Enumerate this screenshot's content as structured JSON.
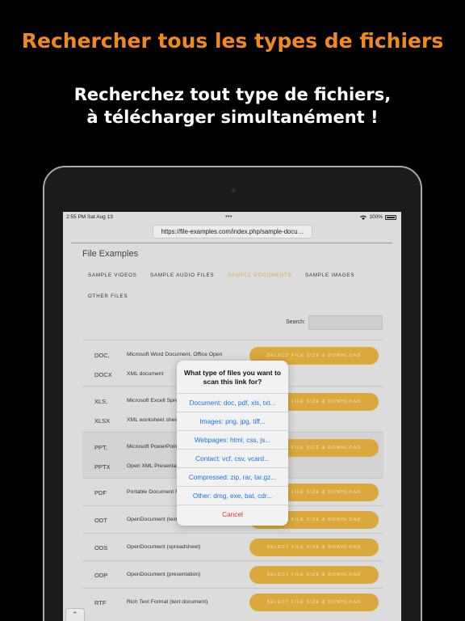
{
  "promo": {
    "title": "Rechercher tous les types de fichiers",
    "subtitle_line1": "Recherchez tout type de fichiers,",
    "subtitle_line2": "à télécharger simultanément !"
  },
  "status_bar": {
    "time": "2:55 PM  Sat Aug 13",
    "more": "•••",
    "battery": "100%"
  },
  "browser": {
    "url": "https://file-examples.com/index.php/sample-docu…"
  },
  "site": {
    "title": "File Examples",
    "nav": [
      "SAMPLE VIDEOS",
      "SAMPLE AUDIO FILES",
      "SAMPLE DOCUMENTS",
      "SAMPLE IMAGES",
      "OTHER FILES"
    ],
    "active_nav": "SAMPLE DOCUMENTS",
    "search_label": "Search:"
  },
  "files": [
    {
      "ext": "DOC,",
      "desc": "Microsoft Word Document, Office Open",
      "button": "SELECT FILE SIZE & DOWNLOAD"
    },
    {
      "ext": "DOCX",
      "desc": "XML document",
      "button": ""
    },
    {
      "ext": "XLS,",
      "desc": "Microsoft Excell Spreadsheet",
      "button": "SELECT FILE SIZE & DOWNLOAD"
    },
    {
      "ext": "XLSX",
      "desc": "XML worksheet sheet",
      "button": ""
    },
    {
      "ext": "PPT,",
      "desc": "Microsoft PowerPoint",
      "button": "SELECT FILE SIZE & DOWNLOAD"
    },
    {
      "ext": "PPTX",
      "desc": "Open XML Presentation",
      "button": ""
    },
    {
      "ext": "PDF",
      "desc": "Portable Document Format",
      "button": "SELECT FILE SIZE & DOWNLOAD"
    },
    {
      "ext": "ODT",
      "desc": "OpenDocument (text)",
      "button": "SELECT FILE SIZE & DOWNLOAD"
    },
    {
      "ext": "ODS",
      "desc": "OpenDocument (spreadsheet)",
      "button": "SELECT FILE SIZE & DOWNLOAD"
    },
    {
      "ext": "ODP",
      "desc": "OpenDocument (presentation)",
      "button": "SELECT FILE SIZE & DOWNLOAD"
    },
    {
      "ext": "RTF",
      "desc": "Rich Text Format (text document)",
      "button": "SELECT FILE SIZE & DOWNLOAD"
    }
  ],
  "dialog": {
    "title": "What type of files you want to scan this link for?",
    "options": [
      "Document: doc, pdf, xls, txt...",
      "Images: png, jpg, tiff...",
      "Webpages: html, css, js...",
      "Contact: vcf, csv, vcard...",
      "Compressed: zip, rar, tar.gz...",
      "Other: dmg, exe, bat, cdr..."
    ],
    "cancel": "Cancel"
  },
  "colors": {
    "accent": "#f08a1e",
    "button_gold": "#d9a93e",
    "link_blue": "#1a73e8",
    "cancel_red": "#e0322a"
  }
}
